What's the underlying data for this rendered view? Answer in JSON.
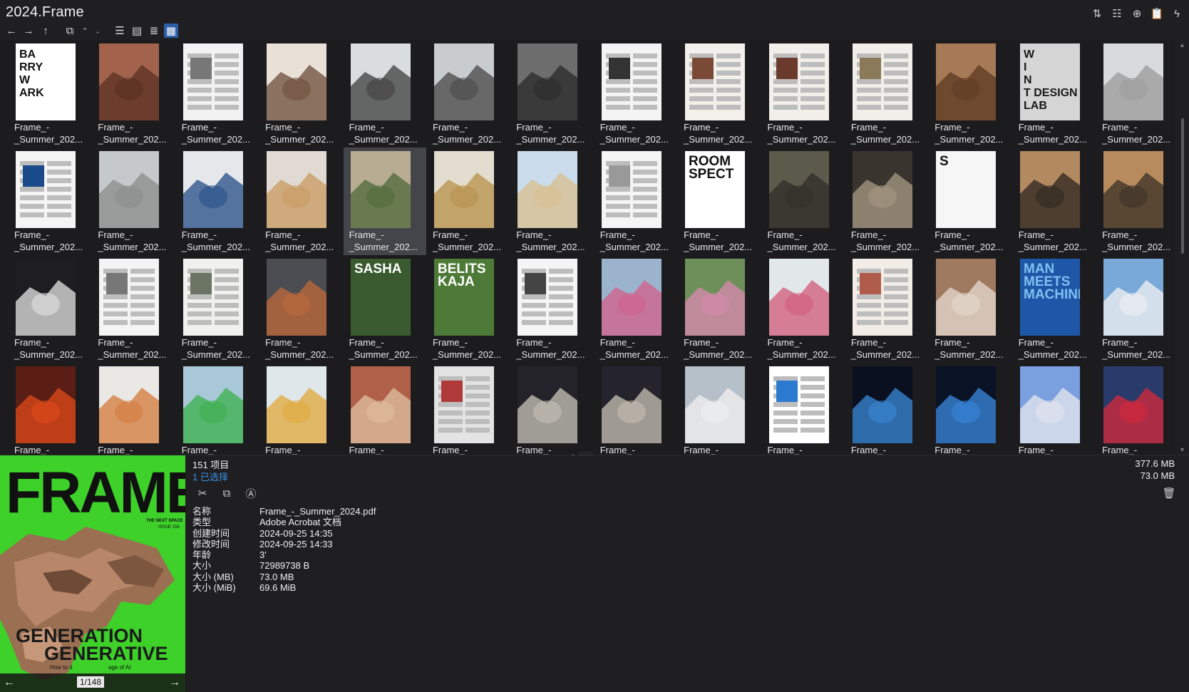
{
  "window": {
    "title": "2024.Frame"
  },
  "toolbar": {
    "nav": [
      {
        "name": "back-icon",
        "glyph": "←"
      },
      {
        "name": "forward-icon",
        "glyph": "→"
      },
      {
        "name": "up-icon",
        "glyph": "↑"
      },
      {
        "name": "window-icon",
        "glyph": "⧉"
      },
      {
        "name": "chevron-up-icon",
        "glyph": "⌃"
      },
      {
        "name": "chevron-down-icon",
        "glyph": "⌄"
      },
      {
        "name": "list-view-icon",
        "glyph": "☰"
      },
      {
        "name": "tile-view-icon",
        "glyph": "▤"
      },
      {
        "name": "details-view-icon",
        "glyph": "≣"
      },
      {
        "name": "thumbnail-view-icon",
        "glyph": "▦"
      }
    ],
    "right": [
      {
        "name": "sort-icon",
        "glyph": "⇅"
      },
      {
        "name": "list-options-icon",
        "glyph": "☷"
      },
      {
        "name": "new-icon",
        "glyph": "⊕"
      },
      {
        "name": "clipboard-icon",
        "glyph": "📋"
      },
      {
        "name": "flash-icon",
        "glyph": "ϟ"
      }
    ]
  },
  "files": {
    "caption_line1": "Frame_-",
    "caption_line2": "_Summer_202...",
    "row4_caption": "Frame_-",
    "selected_index": 18,
    "thumbs": [
      {
        "bg": "#ffffff",
        "fg": "#111111",
        "text": "BA\nRRY\nW\nARK"
      },
      {
        "bg": "#a2624c",
        "fg": "#5a3022",
        "text": ""
      },
      {
        "bg": "#f2f2f2",
        "fg": "#777777",
        "text": ""
      },
      {
        "bg": "#e9e0d8",
        "fg": "#6b4c38",
        "text": ""
      },
      {
        "bg": "#d9dde0",
        "fg": "#3c3c3c",
        "text": ""
      },
      {
        "bg": "#c9ccce",
        "fg": "#474747",
        "text": ""
      },
      {
        "bg": "#6d6d6d",
        "fg": "#2a2a2a",
        "text": ""
      },
      {
        "bg": "#f4f4f4",
        "fg": "#333333",
        "text": ""
      },
      {
        "bg": "#f3f0ec",
        "fg": "#7a4a36",
        "text": ""
      },
      {
        "bg": "#f2eeea",
        "fg": "#6a3b2c",
        "text": ""
      },
      {
        "bg": "#f1efe9",
        "fg": "#8a7a5a",
        "text": ""
      },
      {
        "bg": "#a77a56",
        "fg": "#5c3a22",
        "text": ""
      },
      {
        "bg": "#d5d5d5",
        "fg": "#1a1a1a",
        "text": "W\nI\nN\nT DESIGN\nLAB"
      },
      {
        "bg": "#d9dadc",
        "fg": "#9a9a9a",
        "text": ""
      },
      {
        "bg": "#f5f5f5",
        "fg": "#1a4a8a",
        "text": ""
      },
      {
        "bg": "#c6c9cc",
        "fg": "#8b8b8b",
        "text": ""
      },
      {
        "bg": "#e5e7ea",
        "fg": "#234c86",
        "text": ""
      },
      {
        "bg": "#e0dad2",
        "fg": "#c89a60",
        "text": ""
      },
      {
        "bg": "#b8ad92",
        "fg": "#4f6a3a",
        "text": ""
      },
      {
        "bg": "#e3ddd0",
        "fg": "#b8904a",
        "text": ""
      },
      {
        "bg": "#cbdcec",
        "fg": "#d8bf8f",
        "text": ""
      },
      {
        "bg": "#f5f5f5",
        "fg": "#999999",
        "text": ""
      },
      {
        "bg": "#ffffff",
        "fg": "#111111",
        "text": "ROOM\nSPECT"
      },
      {
        "bg": "#5b5a4b",
        "fg": "#2f2f28",
        "text": ""
      },
      {
        "bg": "#3a342f",
        "fg": "#a89a86",
        "text": ""
      },
      {
        "bg": "#f6f6f6",
        "fg": "#111111",
        "text": "S"
      },
      {
        "bg": "#b3895f",
        "fg": "#2c2620",
        "text": ""
      },
      {
        "bg": "#b88b5e",
        "fg": "#3a3026",
        "text": ""
      },
      {
        "bg": "#1e1e22",
        "fg": "#e6e6e6",
        "text": ""
      },
      {
        "bg": "#f4f4f4",
        "fg": "#777777",
        "text": ""
      },
      {
        "bg": "#f1f1ef",
        "fg": "#6b7462",
        "text": ""
      },
      {
        "bg": "#4c4d52",
        "fg": "#c06a3a",
        "text": ""
      },
      {
        "bg": "#3a5a2f",
        "fg": "#ffffff",
        "text": "SASHA"
      },
      {
        "bg": "#4e7a37",
        "fg": "#ffffff",
        "text": "BELITS\nKAJA"
      },
      {
        "bg": "#f5f5f5",
        "fg": "#444444",
        "text": ""
      },
      {
        "bg": "#9bb3cd",
        "fg": "#d35f8a",
        "text": ""
      },
      {
        "bg": "#6f8f5a",
        "fg": "#d98ab0",
        "text": ""
      },
      {
        "bg": "#e2e7ea",
        "fg": "#d25a7a",
        "text": ""
      },
      {
        "bg": "#f2ede6",
        "fg": "#b05c4a",
        "text": ""
      },
      {
        "bg": "#a07a60",
        "fg": "#e5dcd0",
        "text": ""
      },
      {
        "bg": "#1f57a8",
        "fg": "#7ec0f0",
        "text": "MAN\nMEETS\nMACHINE"
      },
      {
        "bg": "#79a9d8",
        "fg": "#f2f2f2",
        "text": ""
      },
      {
        "bg": "#5a1e14",
        "fg": "#e04a1a",
        "text": ""
      },
      {
        "bg": "#eae8e5",
        "fg": "#d47a3a",
        "text": ""
      },
      {
        "bg": "#a8c8d8",
        "fg": "#3ab04a",
        "text": ""
      },
      {
        "bg": "#dfe7ea",
        "fg": "#e0a83a",
        "text": ""
      },
      {
        "bg": "#b06048",
        "fg": "#e0c0a0",
        "text": ""
      },
      {
        "bg": "#e3e3e3",
        "fg": "#b03a3a",
        "text": ""
      },
      {
        "bg": "#24232a",
        "fg": "#c9c5bb",
        "text": ""
      },
      {
        "bg": "#25242c",
        "fg": "#c8c1b4",
        "text": ""
      },
      {
        "bg": "#b6c0c8",
        "fg": "#f0f0f0",
        "text": ""
      },
      {
        "bg": "#ffffff",
        "fg": "#2a7bd0",
        "text": ""
      },
      {
        "bg": "#0a1020",
        "fg": "#3a8ad8",
        "text": ""
      },
      {
        "bg": "#0a1226",
        "fg": "#3b8ae0",
        "text": ""
      },
      {
        "bg": "#7aa0e0",
        "fg": "#e8e8ee",
        "text": ""
      },
      {
        "bg": "#2a3a6a",
        "fg": "#d8283a",
        "text": ""
      }
    ]
  },
  "preview": {
    "page_indicator": "1/148",
    "bg": "#3dd12a",
    "masthead": "FRAME",
    "cover_line1": "GENERATION",
    "cover_line2": "GENERATIVE",
    "cover_small1": "THE NEXT SPACE",
    "cover_small2": "ISSUE 159",
    "cover_bottom": "How to d",
    "cover_bottom2": "age of AI",
    "prev_label": "←",
    "next_label": "→"
  },
  "info": {
    "item_count": "151 项目",
    "selected_count": "1 已选择",
    "total_size": "377.6 MB",
    "selected_size": "73.0 MB",
    "actions": [
      {
        "name": "cut-icon",
        "glyph": "✂"
      },
      {
        "name": "copy-icon",
        "glyph": "⧉"
      },
      {
        "name": "rename-icon",
        "glyph": "Ⓐ"
      }
    ],
    "delete_glyph": "🗑",
    "properties": [
      {
        "key": "名称",
        "value": "Frame_-_Summer_2024.pdf"
      },
      {
        "key": "类型",
        "value": "Adobe Acrobat 文档"
      },
      {
        "key": "创建时间",
        "value": "2024-09-25  14:35"
      },
      {
        "key": "修改时间",
        "value": "2024-09-25  14:33"
      },
      {
        "key": "年龄",
        "value": "3'"
      },
      {
        "key": "大小",
        "value": "72989738 B"
      },
      {
        "key": "大小 (MB)",
        "value": "73.0 MB"
      },
      {
        "key": "大小 (MiB)",
        "value": "69.6 MiB"
      }
    ]
  }
}
